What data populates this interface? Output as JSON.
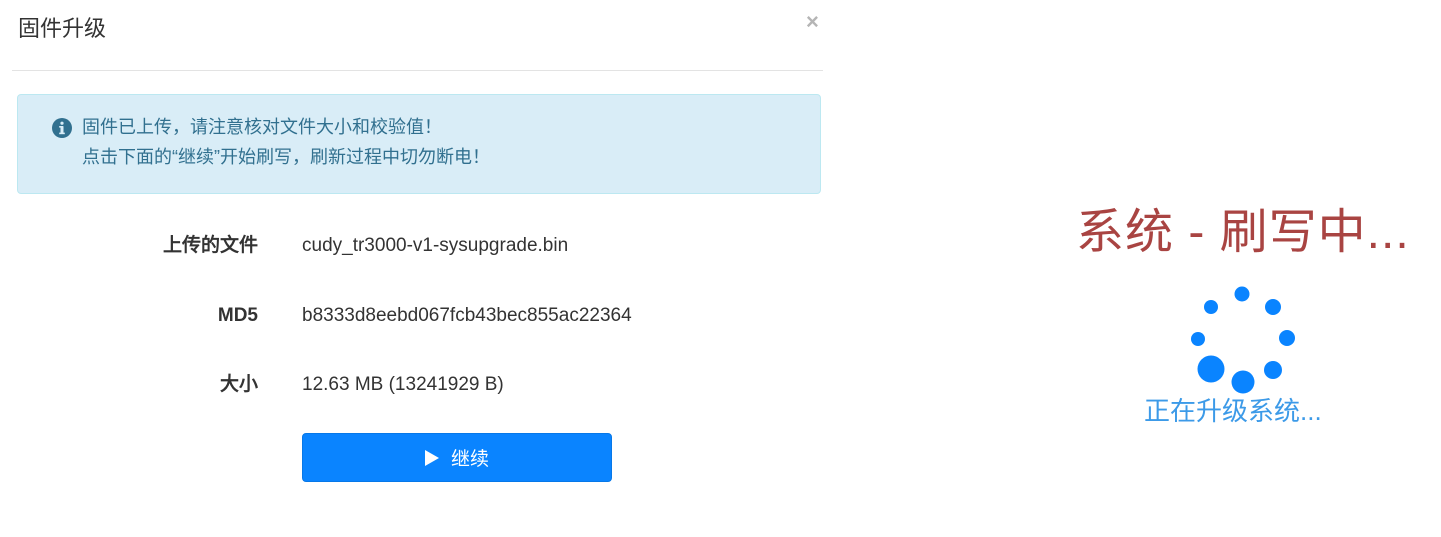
{
  "dialog": {
    "title": "固件升级",
    "close_symbol": "×",
    "alert": {
      "icon": "info-circle-icon",
      "line1": "固件已上传，请注意核对文件大小和校验值！",
      "line2": "点击下面的“继续”开始刷写，刷新过程中切勿断电！"
    },
    "rows": [
      {
        "label": "上传的文件",
        "value": "cudy_tr3000-v1-sysupgrade.bin"
      },
      {
        "label": "MD5",
        "value": "b8333d8eebd067fcb43bec855ac22364"
      },
      {
        "label": "大小",
        "value": "12.63 MB (13241929 B)"
      }
    ],
    "continue_button": {
      "icon": "play-icon",
      "label": "继续"
    }
  },
  "flash_status": {
    "title": "系统 - 刷写中...",
    "subtitle": "正在升级系统...",
    "spinner_icon": "loading-spinner-icon"
  },
  "colors": {
    "alert_bg": "#d9edf7",
    "alert_text": "#31708f",
    "button_bg": "#0a84ff",
    "flash_title": "#a94442",
    "spinner": "#0a84ff",
    "subtitle": "#3c9ae8"
  }
}
